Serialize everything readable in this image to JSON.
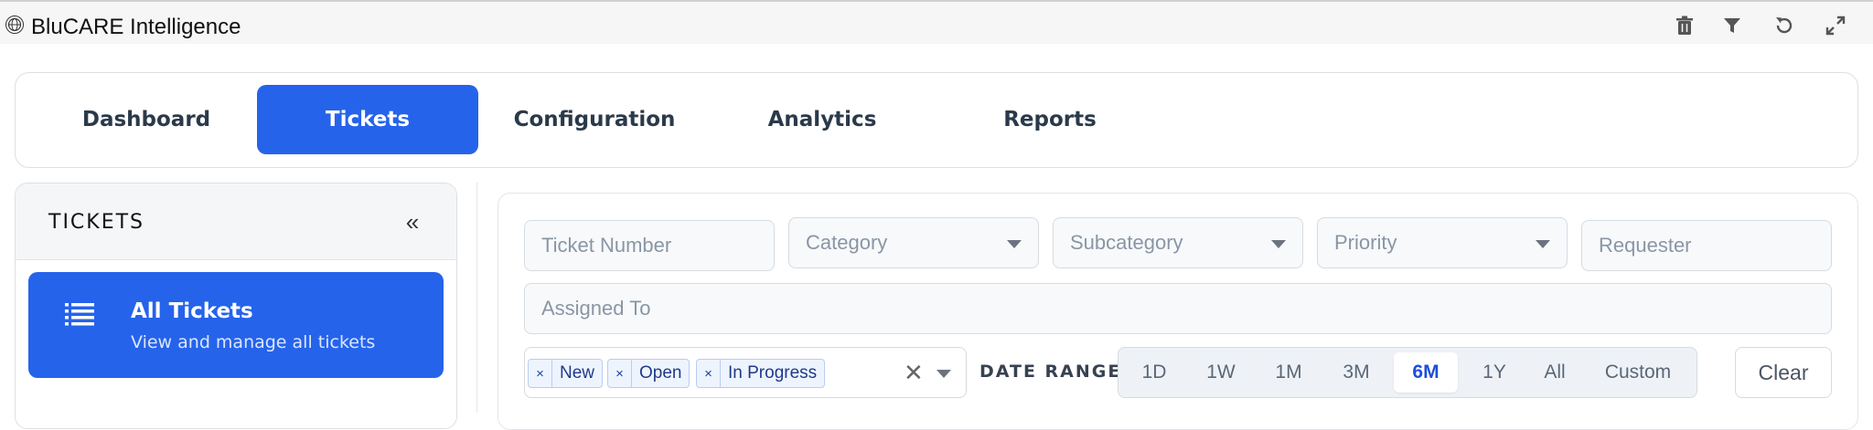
{
  "app": {
    "title": "BluCARE Intelligence",
    "logo_icon": "globe-logo-icon"
  },
  "toolbar": {
    "icons": [
      "trash-icon",
      "filter-icon",
      "refresh-icon",
      "expand-icon"
    ]
  },
  "tabs": [
    {
      "label": "Dashboard",
      "active": false
    },
    {
      "label": "Tickets",
      "active": true
    },
    {
      "label": "Configuration",
      "active": false
    },
    {
      "label": "Analytics",
      "active": false
    },
    {
      "label": "Reports",
      "active": false
    }
  ],
  "sidebar": {
    "title": "TICKETS",
    "collapse_glyph": "«",
    "items": [
      {
        "title": "All Tickets",
        "subtitle": "View and manage all tickets",
        "icon": "list-icon",
        "active": true
      }
    ]
  },
  "filters": {
    "ticket_number_placeholder": "Ticket Number",
    "category_placeholder": "Category",
    "subcategory_placeholder": "Subcategory",
    "priority_placeholder": "Priority",
    "requester_placeholder": "Requester",
    "assigned_to_placeholder": "Assigned To",
    "status_chips": [
      "New",
      "Open",
      "In Progress"
    ],
    "chip_remove_glyph": "×",
    "clear_all_glyph": "✕",
    "date_range_label": "DATE RANGE",
    "date_ranges": [
      "1D",
      "1W",
      "1M",
      "3M",
      "6M",
      "1Y",
      "All",
      "Custom"
    ],
    "selected_range": "6M",
    "clear_label": "Clear"
  },
  "colors": {
    "accent": "#2563eb",
    "chip_bg": "#eef4fd",
    "active_range_text": "#1d4ed8"
  }
}
